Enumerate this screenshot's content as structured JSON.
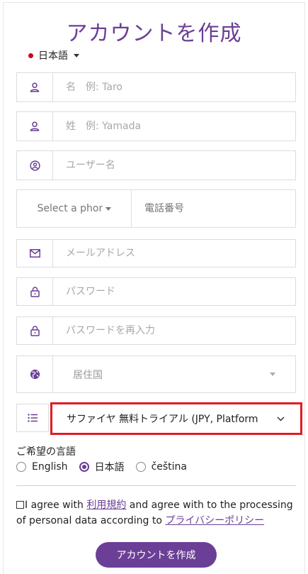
{
  "title": "アカウントを作成",
  "language_switch": {
    "label": "日本語"
  },
  "fields": {
    "first_name": {
      "placeholder": "名　例: Taro"
    },
    "last_name": {
      "placeholder": "姓　例: Yamada"
    },
    "username": {
      "placeholder": "ユーザー名"
    },
    "phone_code": {
      "label": "Select a phone"
    },
    "phone_number": {
      "placeholder": "電話番号"
    },
    "email": {
      "placeholder": "メールアドレス"
    },
    "password": {
      "placeholder": "パスワード"
    },
    "password_confirm": {
      "placeholder": "パスワードを再入力"
    },
    "country": {
      "placeholder": "居住国"
    },
    "plan": {
      "value": "サファイヤ 無料トライアル (JPY, Platform"
    }
  },
  "preferred_language": {
    "label": "ご希望の言語",
    "options": [
      {
        "label": "English",
        "selected": false
      },
      {
        "label": "日本語",
        "selected": true
      },
      {
        "label": "čeština",
        "selected": false
      }
    ]
  },
  "agreement": {
    "text_1": "I agree with ",
    "terms_link": "利用規約",
    "text_2": " and agree with to the processing of personal data according to ",
    "privacy_link": "プライバシーポリシー"
  },
  "submit_label": "アカウントを作成",
  "colors": {
    "accent": "#6b3f96",
    "highlight": "#e31b23"
  }
}
